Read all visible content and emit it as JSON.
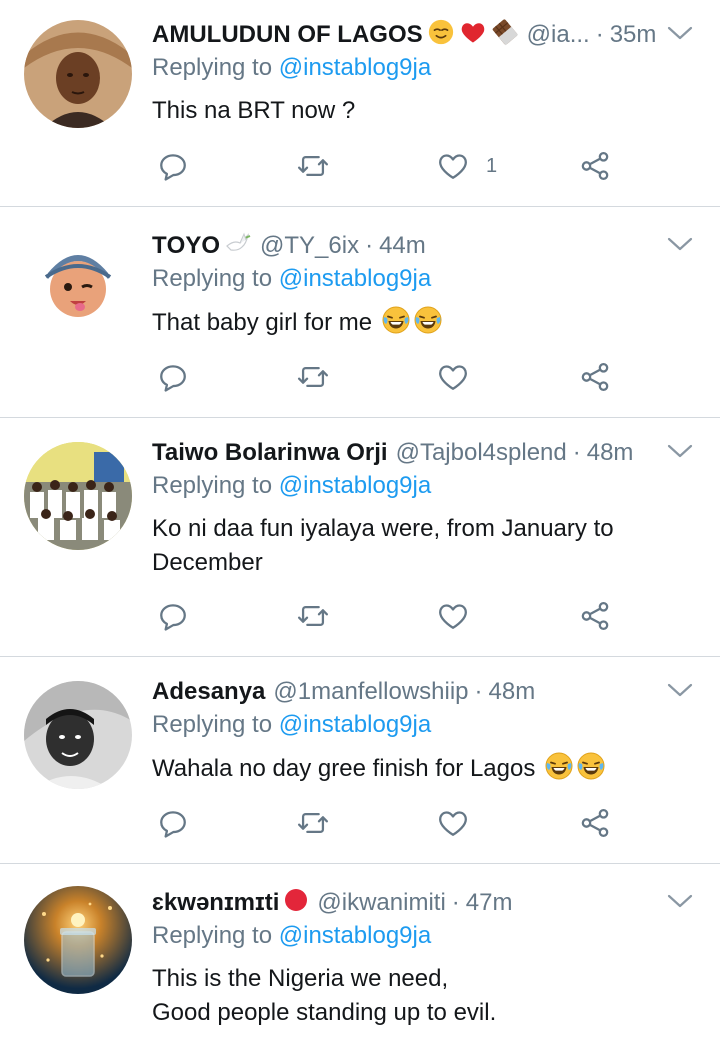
{
  "tweets": [
    {
      "name": "AMULUDUN OF LAGOS",
      "name_emojis": [
        "relieved-face",
        "red-heart",
        "chocolate-bar"
      ],
      "handle": "@ia...",
      "dot": "·",
      "time": "35m",
      "replying_prefix": "Replying to",
      "replying_to": "@instablog9ja",
      "text": "This na BRT now ?",
      "like_count": "1"
    },
    {
      "name": "TΟYΟ",
      "name_emojis": [
        "dove"
      ],
      "handle": "@TY_6ix",
      "dot": "·",
      "time": "44m",
      "replying_prefix": "Replying to",
      "replying_to": "@instablog9ja",
      "text": "That baby girl for me",
      "trailing_emojis": [
        "tears-of-joy",
        "tears-of-joy"
      ],
      "like_count": ""
    },
    {
      "name": "Taiwo Bolarinwa Orji",
      "handle": "@Tajbol4splend",
      "dot": "·",
      "time": "48m",
      "replying_prefix": "Replying to",
      "replying_to": "@instablog9ja",
      "text": "Ko ni daa fun iyalaya were, from January to December",
      "like_count": ""
    },
    {
      "name": "Adesanya",
      "handle": "@1manfellowshiip",
      "dot": "·",
      "time": "48m",
      "replying_prefix": "Replying to",
      "replying_to": "@instablog9ja",
      "text": "Wahala no day gree finish for Lagos",
      "trailing_emojis": [
        "tears-of-joy",
        "tears-of-joy"
      ],
      "like_count": ""
    },
    {
      "name": "ɛkwənɪmɪti",
      "name_emojis": [
        "red-circle"
      ],
      "handle": "@ikwanimiti",
      "dot": "·",
      "time": "47m",
      "replying_prefix": "Replying to",
      "replying_to": "@instablog9ja",
      "text_lines": [
        "This is the Nigeria we need,",
        "Good people standing up to evil."
      ]
    }
  ],
  "icons": [
    "reply-icon",
    "retweet-icon",
    "like-icon",
    "share-icon",
    "chevron-down-icon"
  ],
  "colors": {
    "text": "#14171a",
    "secondary": "#657786",
    "link": "#1d9bf0",
    "divider": "#d4d9de"
  }
}
